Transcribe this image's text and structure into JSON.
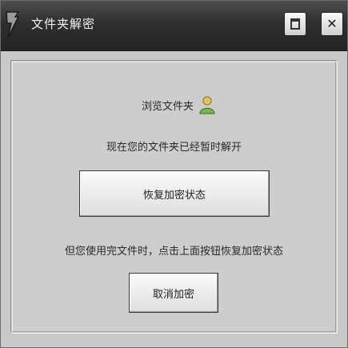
{
  "window": {
    "title": "文件夹解密"
  },
  "titlebar_buttons": {
    "minimize_icon": "minimize-icon",
    "close_symbol": "✕"
  },
  "content": {
    "browse_label": "浏览文件夹",
    "status_message": "现在您的文件夹已经暂时解开",
    "restore_button_label": "恢复加密状态",
    "hint_message": "但您使用完文件时，点击上面按钮恢复加密状态",
    "cancel_button_label": "取消加密"
  },
  "colors": {
    "titlebar": "#2f2f2f",
    "window_bg": "#c9c9c9",
    "user_icon_body": "#7ab648",
    "user_icon_head": "#e9c35a"
  }
}
